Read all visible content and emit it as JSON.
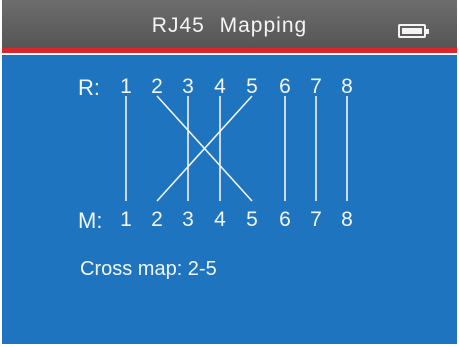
{
  "header": {
    "title": "RJ45  Mapping",
    "battery_icon": "battery-full-icon"
  },
  "mapping": {
    "remote_label": "R:",
    "main_label": "M:",
    "remote_pins": [
      "1",
      "2",
      "3",
      "4",
      "5",
      "6",
      "7",
      "8"
    ],
    "main_pins": [
      "1",
      "2",
      "3",
      "4",
      "5",
      "6",
      "7",
      "8"
    ],
    "connections": [
      [
        1,
        1
      ],
      [
        2,
        5
      ],
      [
        3,
        3
      ],
      [
        4,
        4
      ],
      [
        5,
        2
      ],
      [
        6,
        6
      ],
      [
        7,
        7
      ],
      [
        8,
        8
      ]
    ]
  },
  "result": {
    "text": "Cross map: 2-5"
  },
  "colors": {
    "panel": "#1e74bf",
    "header": "#5f5f5f",
    "accent_line": "#d8262c",
    "foreground": "#f2f6fa"
  }
}
